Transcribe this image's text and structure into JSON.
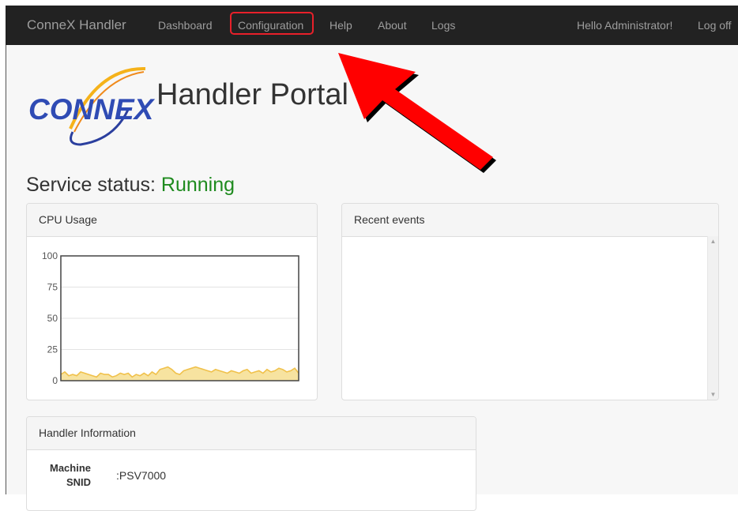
{
  "nav": {
    "brand": "ConneX Handler",
    "links": [
      "Dashboard",
      "Configuration",
      "Help",
      "About",
      "Logs"
    ],
    "greeting": "Hello Administrator!",
    "logoff": "Log off"
  },
  "logo": {
    "text": "CONNEX"
  },
  "page": {
    "title": "Handler Portal"
  },
  "status": {
    "label": "Service status:",
    "value": "Running",
    "value_color": "#1f8b1f"
  },
  "cpu_panel": {
    "title": "CPU Usage"
  },
  "events_panel": {
    "title": "Recent events"
  },
  "info_panel": {
    "title": "Handler Information",
    "rows": [
      {
        "label": "Machine SNID",
        "value": ":PSV7000"
      }
    ]
  },
  "annotation": {
    "arrow_color": "#ff0000",
    "highlight_color": "#e8202a"
  },
  "chart_data": {
    "type": "area",
    "title": "",
    "xlabel": "",
    "ylabel": "",
    "ylim": [
      0,
      100
    ],
    "yticks": [
      "0",
      "25",
      "50",
      "75",
      "100"
    ],
    "grid": true,
    "legend": "none",
    "series": [
      {
        "color": "#f0c14b",
        "values": [
          5,
          7,
          4,
          5,
          4,
          7,
          6,
          5,
          4,
          3,
          6,
          5,
          5,
          3,
          4,
          6,
          5,
          6,
          3,
          5,
          4,
          6,
          4,
          7,
          5,
          9,
          10,
          11,
          9,
          6,
          5,
          8,
          9,
          10,
          11,
          10,
          9,
          8,
          7,
          9,
          8,
          7,
          6,
          8,
          7,
          6,
          8,
          9,
          6,
          7,
          8,
          6,
          9,
          7,
          8,
          10,
          9,
          7,
          8,
          10,
          6
        ]
      }
    ]
  }
}
